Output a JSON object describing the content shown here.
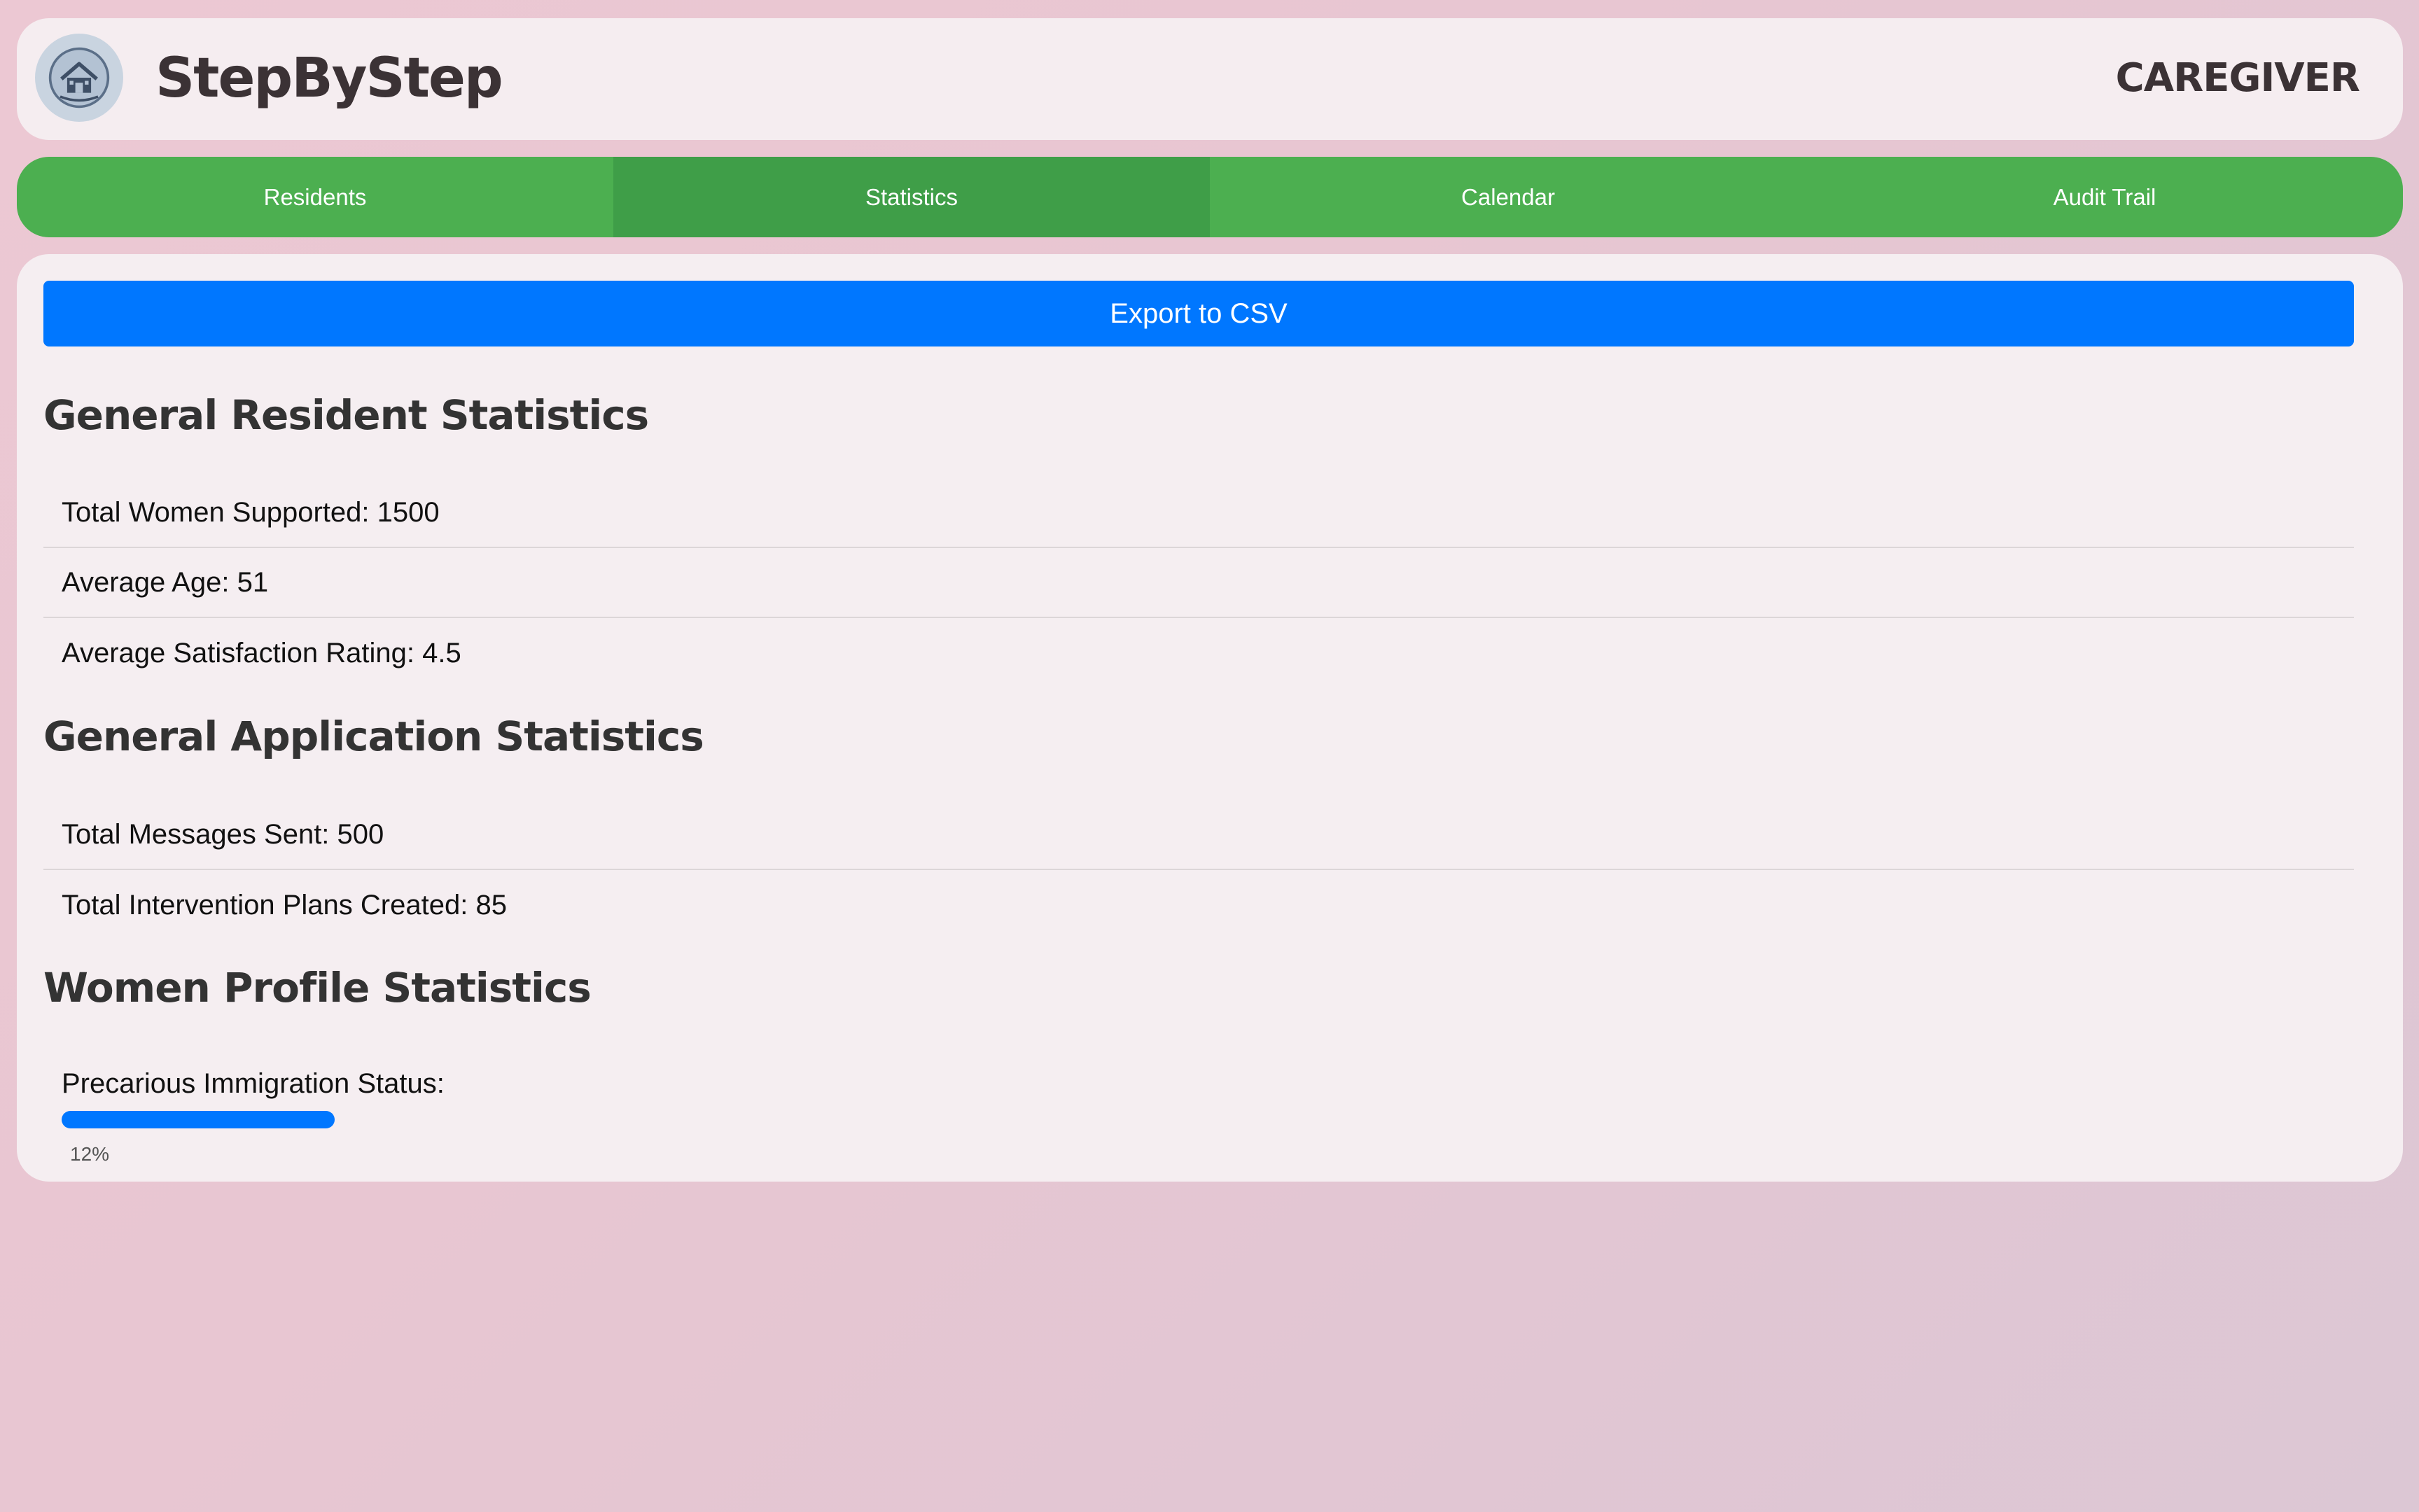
{
  "header": {
    "app_title": "StepByStep",
    "role": "CAREGIVER",
    "logo_icon": "home-logo-icon"
  },
  "tabs": [
    {
      "label": "Residents",
      "active": false
    },
    {
      "label": "Statistics",
      "active": true
    },
    {
      "label": "Calendar",
      "active": false
    },
    {
      "label": "Audit Trail",
      "active": false
    }
  ],
  "main": {
    "export_label": "Export to CSV",
    "sections": {
      "resident": {
        "title": "General Resident Statistics",
        "rows": [
          "Total Women Supported: 1500",
          "Average Age: 51",
          "Average Satisfaction Rating: 4.5"
        ]
      },
      "application": {
        "title": "General Application Statistics",
        "rows": [
          "Total Messages Sent: 500",
          "Total Intervention Plans Created: 85"
        ]
      },
      "profile": {
        "title": "Women Profile Statistics",
        "items": [
          {
            "label": "Precarious Immigration Status:",
            "percent_label": "12%",
            "percent": 12
          }
        ]
      }
    }
  },
  "colors": {
    "tab_bar": "#4caf50",
    "tab_active": "#3f9e48",
    "primary": "#0077ff",
    "text_dark": "#333333"
  }
}
